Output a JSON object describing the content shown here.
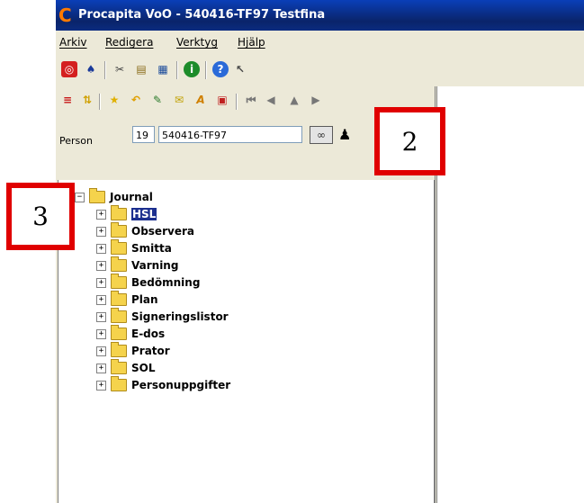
{
  "window": {
    "title": "Procapita VoO - 540416-TF97 Testfina"
  },
  "menu": [
    "Arkiv",
    "Redigera",
    "Verktyg",
    "Hjälp"
  ],
  "person": {
    "label": "Person",
    "number": "19",
    "id": "540416-TF97"
  },
  "tree": {
    "root": "Journal",
    "children": [
      "HSL",
      "Observera",
      "Smitta",
      "Varning",
      "Bedömning",
      "Plan",
      "Signeringslistor",
      "E-dos",
      "Prator",
      "SOL",
      "Personuppgifter"
    ],
    "selected": "HSL"
  },
  "callouts": {
    "two": "2",
    "three": "3"
  },
  "colors": {
    "title_bar": "#0a246a",
    "callout_border": "#e00000",
    "selection": "#1c2f8f"
  }
}
